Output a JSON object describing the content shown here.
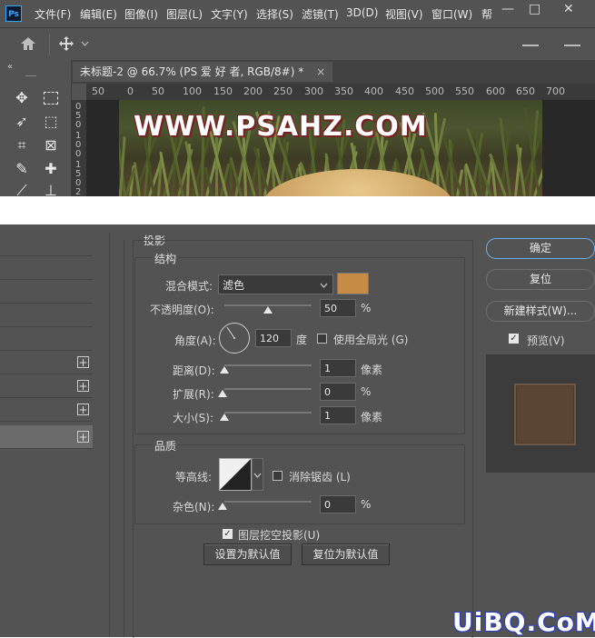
{
  "app": {
    "logo": "Ps",
    "menu": [
      "文件(F)",
      "编辑(E)",
      "图像(I)",
      "图层(L)",
      "文字(Y)",
      "选择(S)",
      "滤镜(T)",
      "3D(D)",
      "视图(V)",
      "窗口(W)",
      "帮"
    ],
    "window_controls": [
      "—",
      "□",
      "✕"
    ]
  },
  "document": {
    "tab_title": "未标题-2 @ 66.7% (PS 爱 好 者, RGB/8#) *",
    "close_glyph": "×",
    "ruler_h_ticks": [
      "50",
      "0",
      "50",
      "100",
      "150",
      "200",
      "250",
      "300",
      "350",
      "400",
      "450",
      "500",
      "550",
      "600",
      "650",
      "700"
    ],
    "ruler_v_ticks": [
      "0",
      "5",
      "0",
      "1",
      "0",
      "0",
      "1",
      "5",
      "0",
      "2"
    ],
    "watermark": "WWW.PSAHZ.COM"
  },
  "dialog": {
    "section_title": "投影",
    "structure": {
      "title": "结构",
      "blend_mode_label": "混合模式:",
      "blend_mode_value": "滤色",
      "color_swatch": "#c68b45",
      "opacity_label": "不透明度(O):",
      "opacity_value": "50",
      "opacity_unit": "%",
      "opacity_level": 0.5,
      "angle_label": "角度(A):",
      "angle_value": "120",
      "angle_unit": "度",
      "global_light_label": "使用全局光 (G)",
      "global_light_checked": false,
      "distance_label": "距离(D):",
      "distance_value": "1",
      "distance_unit": "像素",
      "spread_label": "扩展(R):",
      "spread_value": "0",
      "spread_unit": "%",
      "size_label": "大小(S):",
      "size_value": "1",
      "size_unit": "像素"
    },
    "quality": {
      "title": "品质",
      "contour_label": "等高线:",
      "anti_alias_label": "消除锯齿 (L)",
      "anti_alias_checked": false,
      "noise_label": "杂色(N):",
      "noise_value": "0",
      "noise_unit": "%"
    },
    "knockout_label": "图层挖空投影(U)",
    "knockout_checked": true,
    "set_default_label": "设置为默认值",
    "reset_default_label": "复位为默认值",
    "buttons": {
      "ok": "确定",
      "reset": "复位",
      "new_style": "新建样式(W)...",
      "preview_label": "预览(V)",
      "preview_checked": true
    },
    "preview_color": "#5a4535",
    "left_list_rows": 9
  },
  "site_watermark": "UiBQ.CoM"
}
